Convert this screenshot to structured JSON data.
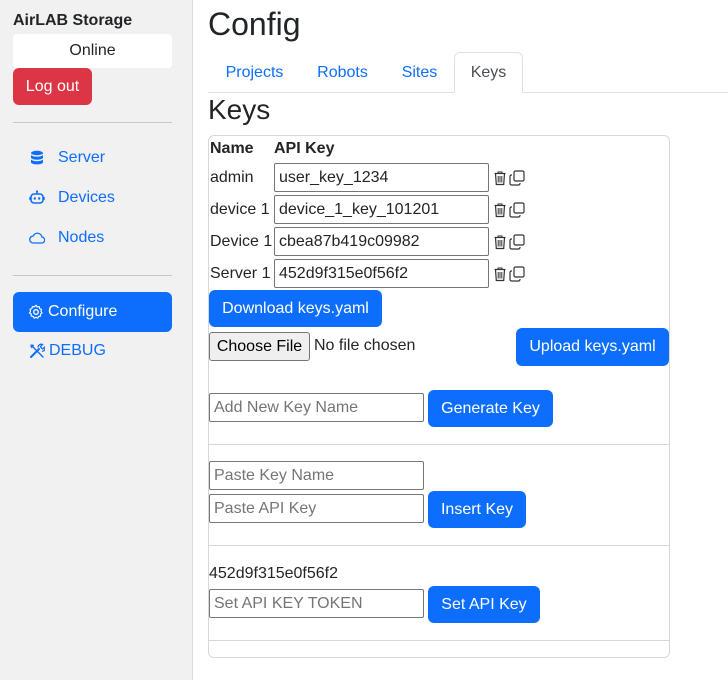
{
  "sidebar": {
    "app_title": "AirLAB Storage",
    "status": "Online",
    "logout_label": "Log out",
    "items": [
      {
        "label": "Server",
        "icon": "database-icon"
      },
      {
        "label": "Devices",
        "icon": "robot-icon"
      },
      {
        "label": "Nodes",
        "icon": "cloud-icon"
      }
    ],
    "configure_label": "Configure",
    "debug_label": "DEBUG"
  },
  "header": {
    "title": "Config",
    "tabs": [
      {
        "label": "Projects"
      },
      {
        "label": "Robots"
      },
      {
        "label": "Sites"
      },
      {
        "label": "Keys",
        "active": true
      }
    ]
  },
  "keys": {
    "section_title": "Keys",
    "columns": [
      "Name",
      "API Key"
    ],
    "rows": [
      {
        "name": "admin",
        "api_key": "user_key_1234"
      },
      {
        "name": "device 1",
        "api_key": "device_1_key_101201"
      },
      {
        "name": "Device 1",
        "api_key": "cbea87b419c09982"
      },
      {
        "name": "Server 1",
        "api_key": "452d9f315e0f56f2"
      }
    ],
    "download_label": "Download keys.yaml",
    "choose_file_label": "Choose File",
    "file_status": "No file chosen",
    "upload_label": "Upload keys.yaml",
    "new_key_placeholder": "Add New Key Name",
    "generate_label": "Generate Key",
    "paste_name_placeholder": "Paste Key Name",
    "paste_key_placeholder": "Paste API Key",
    "insert_label": "Insert Key",
    "current_token": "452d9f315e0f56f2",
    "token_placeholder": "Set API KEY TOKEN",
    "set_key_label": "Set API Key"
  },
  "colors": {
    "primary": "#0d6efd",
    "danger": "#dc3545",
    "sidebar_bg": "#f1f1f1"
  }
}
